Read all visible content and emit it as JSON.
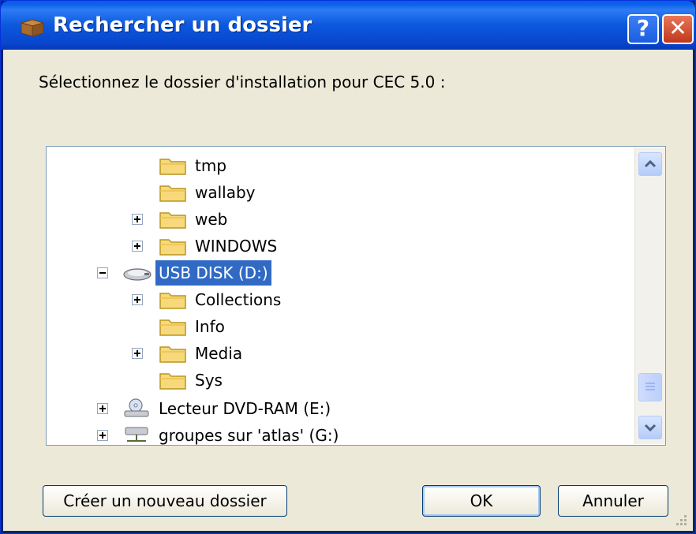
{
  "window": {
    "title": "Rechercher un dossier",
    "help_label": "?",
    "close_label": "✕"
  },
  "prompt": "Sélectionnez le dossier d'installation pour CEC 5.0 :",
  "tree": {
    "items": [
      {
        "label": "tmp",
        "icon": "folder-icon",
        "expander": "none"
      },
      {
        "label": "wallaby",
        "icon": "folder-icon",
        "expander": "none"
      },
      {
        "label": "web",
        "icon": "folder-icon",
        "expander": "plus"
      },
      {
        "label": "WINDOWS",
        "icon": "folder-icon",
        "expander": "plus"
      },
      {
        "label": "USB DISK (D:)",
        "icon": "usb-drive-icon",
        "expander": "minus",
        "selected": true
      },
      {
        "label": "Collections",
        "icon": "folder-icon",
        "expander": "plus"
      },
      {
        "label": "Info",
        "icon": "folder-icon",
        "expander": "none"
      },
      {
        "label": "Media",
        "icon": "folder-icon",
        "expander": "plus"
      },
      {
        "label": "Sys",
        "icon": "folder-icon",
        "expander": "none"
      },
      {
        "label": "Lecteur DVD-RAM (E:)",
        "icon": "dvd-drive-icon",
        "expander": "plus"
      },
      {
        "label": "groupes sur 'atlas' (G:)",
        "icon": "network-drive-icon",
        "expander": "plus"
      }
    ]
  },
  "buttons": {
    "new_folder": "Créer un nouveau dossier",
    "ok": "OK",
    "cancel": "Annuler"
  },
  "colors": {
    "title_bar": "#0a5ce6",
    "selection": "#316ac5",
    "dialog_bg": "#ece9d8",
    "close_button": "#c0381c"
  }
}
